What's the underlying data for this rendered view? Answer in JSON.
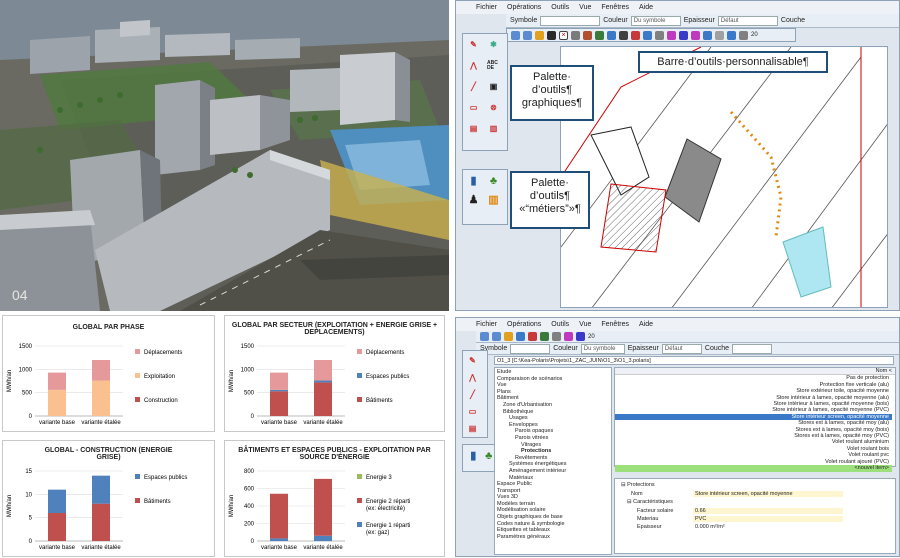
{
  "app": {
    "menu": [
      "Fichier",
      "Opérations",
      "Outils",
      "Vue",
      "Fenêtres",
      "Aide"
    ],
    "toolbar": {
      "symbole_label": "Symbole",
      "couleur_label": "Couleur",
      "couleur_value": "Du symbole",
      "epaisseur_label": "Epaisseur",
      "epaisseur_value": "Défaut",
      "couche_label": "Couche",
      "zoom_value": "20"
    },
    "callouts": {
      "palette_graphique": "Palette· d’outils¶ graphiques¶",
      "barre": "Barre·d’outils·personnalisable¶",
      "palette_metiers": "Palette· d’outils¶ «“métiers”»¶"
    },
    "icon_labels": {
      "abc": "ABC DE"
    }
  },
  "charts_section": {
    "phase": {
      "title": "GLOBAL PAR PHASE",
      "ylabel": "MWh/an",
      "yticks": [
        "0",
        "500",
        "1000",
        "1500"
      ],
      "categories": [
        "variante base",
        "variante étalée"
      ],
      "legend": [
        "Déplacements",
        "Exploitation",
        "Construction"
      ]
    },
    "secteur": {
      "title": "GLOBAL PAR SECTEUR (EXPLOITATION + ENERGIE GRISE + DEPLACEMENTS)",
      "ylabel": "MWh/an",
      "yticks": [
        "0",
        "500",
        "1000",
        "1500"
      ],
      "categories": [
        "variante base",
        "variante étalée"
      ],
      "legend": [
        "Déplacements",
        "Espaces publics",
        "Bâtiments"
      ]
    },
    "construction": {
      "title": "GLOBAL - CONSTRUCTION (ENERGIE GRISE)",
      "ylabel": "MWh/an",
      "yticks": [
        "0",
        "5",
        "10",
        "15"
      ],
      "categories": [
        "variante base",
        "variante étalée"
      ],
      "legend": [
        "Espaces publics",
        "Bâtiments"
      ]
    },
    "source": {
      "title": "BÂTIMENTS ET ESPACES PUBLICS - EXPLOITATION PAR SOURCE D'ÉNERGIE",
      "ylabel": "MWh/an",
      "yticks": [
        "0",
        "200",
        "400",
        "600",
        "800"
      ],
      "categories": [
        "variante base",
        "variante étalée"
      ],
      "legend": [
        "Energie 3",
        "Energie 2 réparti (ex: électricité)",
        "Energie 1 réparti (ex: gaz)"
      ]
    }
  },
  "chart_data": [
    {
      "type": "bar",
      "title": "GLOBAL PAR PHASE",
      "ylabel": "MWh/an",
      "ylim": [
        0,
        1500
      ],
      "categories": [
        "variante base",
        "variante étalée"
      ],
      "series": [
        {
          "name": "Construction",
          "values": [
            0,
            0
          ],
          "color": "#c0504d"
        },
        {
          "name": "Exploitation",
          "values": [
            560,
            760
          ],
          "color": "#fac090"
        },
        {
          "name": "Déplacements",
          "values": [
            370,
            440
          ],
          "color": "#e6999a"
        }
      ]
    },
    {
      "type": "bar",
      "title": "GLOBAL PAR SECTEUR (EXPLOITATION + ENERGIE GRISE + DEPLACEMENTS)",
      "ylabel": "MWh/an",
      "ylim": [
        0,
        1500
      ],
      "categories": [
        "variante base",
        "variante étalée"
      ],
      "series": [
        {
          "name": "Bâtiments",
          "values": [
            530,
            720
          ],
          "color": "#c0504d"
        },
        {
          "name": "Espaces publics",
          "values": [
            30,
            40
          ],
          "color": "#4f81bd"
        },
        {
          "name": "Déplacements",
          "values": [
            370,
            440
          ],
          "color": "#e6999a"
        }
      ]
    },
    {
      "type": "bar",
      "title": "GLOBAL - CONSTRUCTION (ENERGIE GRISE)",
      "ylabel": "MWh/an",
      "ylim": [
        0,
        15
      ],
      "categories": [
        "variante base",
        "variante étalée"
      ],
      "series": [
        {
          "name": "Bâtiments",
          "values": [
            6,
            8
          ],
          "color": "#c0504d"
        },
        {
          "name": "Espaces publics",
          "values": [
            5,
            6
          ],
          "color": "#4f81bd"
        }
      ]
    },
    {
      "type": "bar",
      "title": "BÂTIMENTS ET ESPACES PUBLICS - EXPLOITATION PAR SOURCE D'ÉNERGIE",
      "ylabel": "MWh/an",
      "ylim": [
        0,
        800
      ],
      "categories": [
        "variante base",
        "variante étalée"
      ],
      "series": [
        {
          "name": "Energie 1 réparti (ex: gaz)",
          "values": [
            30,
            60
          ],
          "color": "#4f81bd"
        },
        {
          "name": "Energie 2 réparti (ex: électricité)",
          "values": [
            510,
            650
          ],
          "color": "#c0504d"
        },
        {
          "name": "Energie 3",
          "values": [
            0,
            0
          ],
          "color": "#9bbb59"
        }
      ]
    }
  ],
  "project": {
    "menu": [
      "Fichier",
      "Opérations",
      "Outils",
      "Vue",
      "Fenêtres",
      "Aide"
    ],
    "toolbar": {
      "symbole_label": "Symbole",
      "couleur_label": "Couleur",
      "couleur_value": "Du symbole",
      "epaisseur_label": "Epaisseur",
      "epaisseur_value": "Défaut",
      "couche_label": "Couche",
      "zoom_value": "20"
    },
    "path": "O1_3 [C:\\Kea-Polaris\\Projets\\1_ZAC_JUIN\\O1_3\\O1_3.polaris]",
    "tree": [
      "Etude",
      "Comparaison de scénarios",
      "Vue",
      "Plans",
      "Bâtiment",
      "Zone d'Urbanisation",
      "Bibliothèque",
      "Usages",
      "Enveloppes",
      "Parois opaques",
      "Parois vitrées",
      "Vitrages",
      "Protections",
      "Revêtements",
      "Systèmes énergétiques",
      "Aménagement intérieur",
      "Matériaux",
      "Espace Public",
      "Transport",
      "Vues 3D",
      "Modèles terrain",
      "Modélisation solaire",
      "Objets graphiques de base",
      "Codes nature & symbologie",
      "Etiquettes et tableaux",
      "Paramètres généraux"
    ],
    "list_header": "Nom <",
    "list": [
      "Pas de protection",
      "Protection fixe verticale (alu)",
      "Store extérieur toile, opacité moyenne",
      "Store intérieur à lames, opacité moyenne (alu)",
      "Store intérieur à lames, opacité moyenne (bois)",
      "Store intérieur à lames, opacité moyenne (PVC)",
      "Store intérieur screen, opacité moyenne",
      "Stores ext à lames, opacité moy (alu)",
      "Stores ext à lames, opacité moy (bois)",
      "Stores ext à lames, opacité moy (PVC)",
      "Volet roulant aluminium",
      "Volet roulant bois",
      "Volet roulant pvc",
      "Volet roulant ajouré (PVC)",
      "<nouvel item>"
    ],
    "props": {
      "section": "Protections",
      "nom_label": "Nom",
      "nom_value": "Store intérieur screen, opacité moyenne",
      "carac_label": "Caractéristiques",
      "facteur_label": "Facteur solaire",
      "facteur_value": "0.66",
      "materiau_label": "Materiau",
      "materiau_value": "PVC",
      "epaisseur_label": "Epaisseur",
      "epaisseur_value": "0.000 m²/m²"
    }
  }
}
